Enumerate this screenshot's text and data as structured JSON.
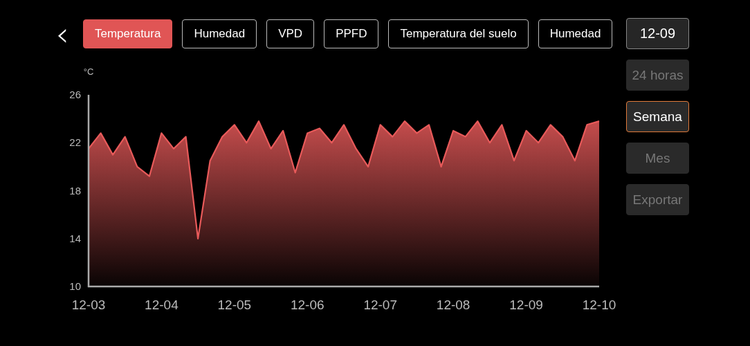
{
  "back_button": {
    "icon": "‹"
  },
  "tabs": [
    {
      "label": "Temperatura",
      "selected": true
    },
    {
      "label": "Humedad",
      "selected": false
    },
    {
      "label": "VPD",
      "selected": false
    },
    {
      "label": "PPFD",
      "selected": false
    },
    {
      "label": "Temperatura del suelo",
      "selected": false
    },
    {
      "label": "Humedad",
      "selected": false
    }
  ],
  "date_button": {
    "label": "12-09"
  },
  "range_buttons": [
    {
      "label": "24 horas",
      "selected": false
    },
    {
      "label": "Semana",
      "selected": true
    },
    {
      "label": "Mes",
      "selected": false
    }
  ],
  "export_button": {
    "label": "Exportar"
  },
  "chart": {
    "unit": "°C",
    "chart_data": {
      "type": "area",
      "ylim": [
        10,
        26
      ],
      "yticks": [
        10,
        14,
        18,
        22,
        26
      ],
      "categories": [
        "12-03",
        null,
        null,
        null,
        null,
        null,
        "12-04",
        null,
        null,
        null,
        null,
        null,
        "12-05",
        null,
        null,
        null,
        null,
        null,
        "12-06",
        null,
        null,
        null,
        null,
        null,
        "12-07",
        null,
        null,
        null,
        null,
        null,
        "12-08",
        null,
        null,
        null,
        null,
        null,
        "12-09",
        null,
        null,
        null,
        null,
        null,
        "12-10"
      ],
      "series": [
        {
          "color": "#e85a5a",
          "values": [
            21.5,
            22.8,
            21.0,
            22.5,
            20.0,
            19.2,
            22.8,
            21.5,
            22.5,
            14.0,
            20.5,
            22.5,
            23.5,
            22.0,
            23.8,
            21.5,
            23.0,
            19.5,
            22.8,
            23.2,
            22.0,
            23.5,
            21.5,
            20.0,
            23.5,
            22.5,
            23.8,
            22.8,
            23.5,
            20.0,
            23.0,
            22.5,
            23.8,
            22.0,
            23.5,
            20.5,
            23.0,
            22.0,
            23.5,
            22.5,
            20.5,
            23.5,
            23.8
          ]
        }
      ]
    }
  }
}
